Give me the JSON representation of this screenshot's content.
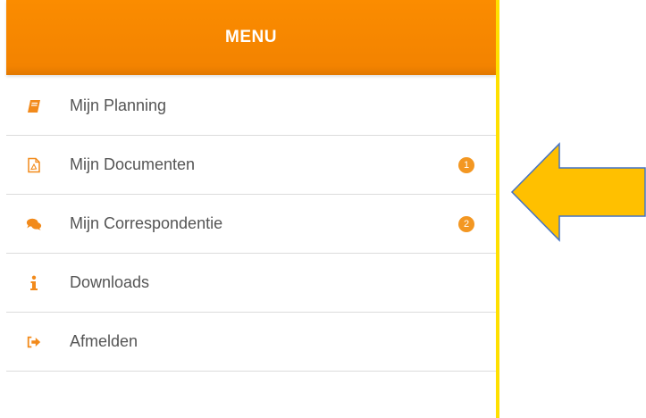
{
  "menu": {
    "title": "MENU",
    "items": [
      {
        "label": "Mijn Planning",
        "icon": "book-icon",
        "badge": null
      },
      {
        "label": "Mijn Documenten",
        "icon": "pdf-file-icon",
        "badge": "1"
      },
      {
        "label": "Mijn Correspondentie",
        "icon": "chat-bubbles-icon",
        "badge": "2"
      },
      {
        "label": "Downloads",
        "icon": "info-icon",
        "badge": null
      },
      {
        "label": "Afmelden",
        "icon": "sign-out-icon",
        "badge": null
      }
    ]
  },
  "annotation": {
    "arrow_color": "#ffc000",
    "arrow_outline": "#4472c4"
  },
  "colors": {
    "header": "#f58400",
    "icon": "#f28a1b",
    "badge": "#f39722",
    "panel_border": "#ffe000"
  }
}
